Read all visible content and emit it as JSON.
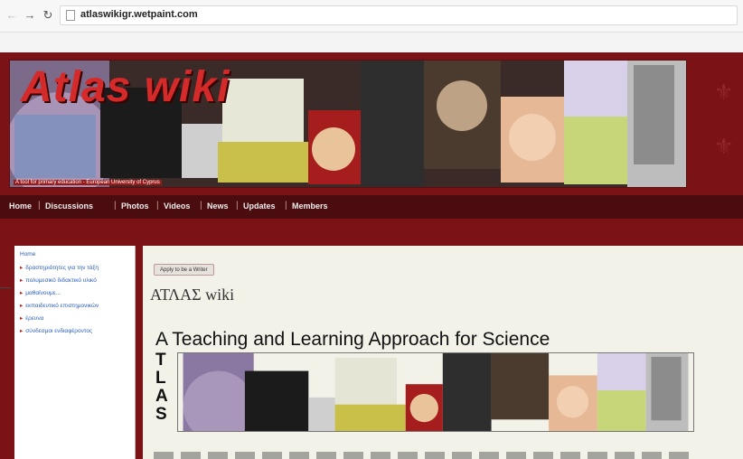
{
  "browser": {
    "url": "atlaswikigr.wetpaint.com",
    "icons": {
      "back": "back-arrow-icon",
      "forward": "forward-arrow-icon",
      "reload": "reload-icon",
      "page": "page-icon"
    }
  },
  "site": {
    "banner_title": "Atlas wiki",
    "banner_caption": "A tool for primary education - European University of Cyprus",
    "nav": [
      "Home",
      "Discussions",
      "Photos",
      "Videos",
      "News",
      "Updates",
      "Members"
    ]
  },
  "sidebar": {
    "items": [
      {
        "label": "Home",
        "bullet": false
      },
      {
        "label": "δραστηριότητες για την τάξη",
        "bullet": true
      },
      {
        "label": "πολυμεσικό διδακτικό υλικό",
        "bullet": true
      },
      {
        "label": "μαθαίνουμε...",
        "bullet": true
      },
      {
        "label": "εκπαιδευτικό επιστημονικών",
        "bullet": true
      },
      {
        "label": "έρευνα",
        "bullet": true
      },
      {
        "label": "σύνδεσμοι ενδιαφέροντος",
        "bullet": true
      }
    ]
  },
  "main": {
    "apply_button": "Apply to be a Writer",
    "page_title": "ΑΤΛΑΣ wiki",
    "tagline": "A Teaching and Learning Approach for Science",
    "acronym": [
      "T",
      "L",
      "A",
      "S"
    ]
  },
  "colors": {
    "brand": "#7a1216",
    "nav": "#4a0c0e",
    "title": "#d42a2a",
    "link": "#2a5fbf"
  }
}
